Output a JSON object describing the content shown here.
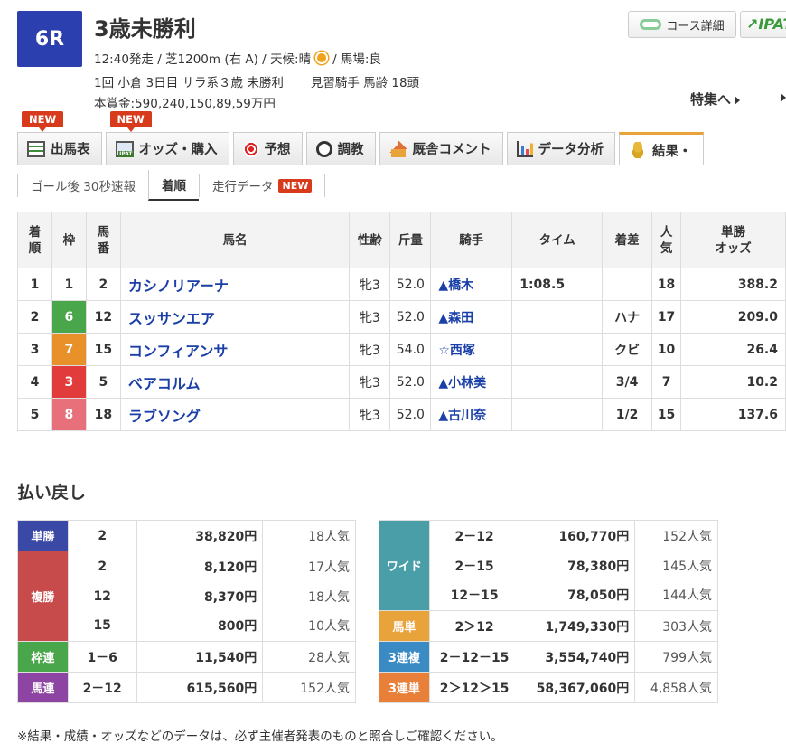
{
  "race": {
    "number": "6R",
    "title": "3歳未勝利",
    "meta1_a": "12:40発走 / 芝1200m (右 A) / 天候:晴",
    "meta1_b": "/ 馬場:良",
    "meta2_a": "1回 小倉 3日目 サラ系３歳 未勝利",
    "meta2_b": "見習騎手 馬齢 18頭",
    "prize": "本賞金:590,240,150,89,59万円"
  },
  "header": {
    "course_detail": "コース詳細",
    "ipat": "↗IPAT",
    "feature": "特集へ"
  },
  "tabs": [
    {
      "label": "出馬表",
      "badge": "NEW"
    },
    {
      "label": "オッズ・購入",
      "badge": "NEW"
    },
    {
      "label": "予想"
    },
    {
      "label": "調教"
    },
    {
      "label": "厩舎コメント"
    },
    {
      "label": "データ分析"
    },
    {
      "label": "結果・"
    }
  ],
  "subtabs": [
    {
      "label": "ゴール後 30秒速報"
    },
    {
      "label": "着順"
    },
    {
      "label": "走行データ",
      "badge": "NEW"
    }
  ],
  "result": {
    "headers": [
      "着\n順",
      "枠",
      "馬\n番",
      "馬名",
      "性齢",
      "斤量",
      "騎手",
      "タイム",
      "着差",
      "人\n気",
      "単勝\nオッズ"
    ],
    "rows": [
      {
        "rank": "1",
        "waku": "1",
        "num": "2",
        "name": "カシノリアーナ",
        "sex": "牝3",
        "weight": "52.0",
        "jockey": "▲橋木",
        "time": "1:08.5",
        "margin": "",
        "pop": "18",
        "odds": "388.2"
      },
      {
        "rank": "2",
        "waku": "6",
        "num": "12",
        "name": "スッサンエア",
        "sex": "牝3",
        "weight": "52.0",
        "jockey": "▲森田",
        "time": "",
        "margin": "ハナ",
        "pop": "17",
        "odds": "209.0"
      },
      {
        "rank": "3",
        "waku": "7",
        "num": "15",
        "name": "コンフィアンサ",
        "sex": "牝3",
        "weight": "54.0",
        "jockey": "☆西塚",
        "time": "",
        "margin": "クビ",
        "pop": "10",
        "odds": "26.4"
      },
      {
        "rank": "4",
        "waku": "3",
        "num": "5",
        "name": "ベアコルム",
        "sex": "牝3",
        "weight": "52.0",
        "jockey": "▲小林美",
        "time": "",
        "margin": "3/4",
        "pop": "7",
        "odds": "10.2"
      },
      {
        "rank": "5",
        "waku": "8",
        "num": "18",
        "name": "ラブソング",
        "sex": "牝3",
        "weight": "52.0",
        "jockey": "▲古川奈",
        "time": "",
        "margin": "1/2",
        "pop": "15",
        "odds": "137.6"
      }
    ]
  },
  "payout": {
    "title": "払い戻し",
    "left": {
      "tansho": {
        "label": "単勝",
        "rows": [
          {
            "num": "2",
            "yen": "38,820円",
            "pop": "18人気"
          }
        ]
      },
      "fukusho": {
        "label": "複勝",
        "rows": [
          {
            "num": "2",
            "yen": "8,120円",
            "pop": "17人気"
          },
          {
            "num": "12",
            "yen": "8,370円",
            "pop": "18人気"
          },
          {
            "num": "15",
            "yen": "800円",
            "pop": "10人気"
          }
        ]
      },
      "wakuren": {
        "label": "枠連",
        "rows": [
          {
            "num": "1－6",
            "yen": "11,540円",
            "pop": "28人気"
          }
        ]
      },
      "umaren": {
        "label": "馬連",
        "rows": [
          {
            "num": "2－12",
            "yen": "615,560円",
            "pop": "152人気"
          }
        ]
      }
    },
    "right": {
      "wide": {
        "label": "ワイド",
        "rows": [
          {
            "num": "2－12",
            "yen": "160,770円",
            "pop": "152人気"
          },
          {
            "num": "2－15",
            "yen": "78,380円",
            "pop": "145人気"
          },
          {
            "num": "12－15",
            "yen": "78,050円",
            "pop": "144人気"
          }
        ]
      },
      "umatan": {
        "label": "馬単",
        "rows": [
          {
            "num": "2＞12",
            "yen": "1,749,330円",
            "pop": "303人気"
          }
        ]
      },
      "sanrenpuku": {
        "label": "3連複",
        "rows": [
          {
            "num": "2－12－15",
            "yen": "3,554,740円",
            "pop": "799人気"
          }
        ]
      },
      "sanrentan": {
        "label": "3連単",
        "rows": [
          {
            "num": "2＞12＞15",
            "yen": "58,367,060円",
            "pop": "4,858人気"
          }
        ]
      }
    }
  },
  "footnote": "※結果・成績・オッズなどのデータは、必ず主催者発表のものと照合しご確認ください。",
  "colors": {
    "accent_tab": "#e8a33b",
    "race_badge": "#2b3fae",
    "link": "#1a3fa8",
    "new_badge": "#d83a1c"
  }
}
